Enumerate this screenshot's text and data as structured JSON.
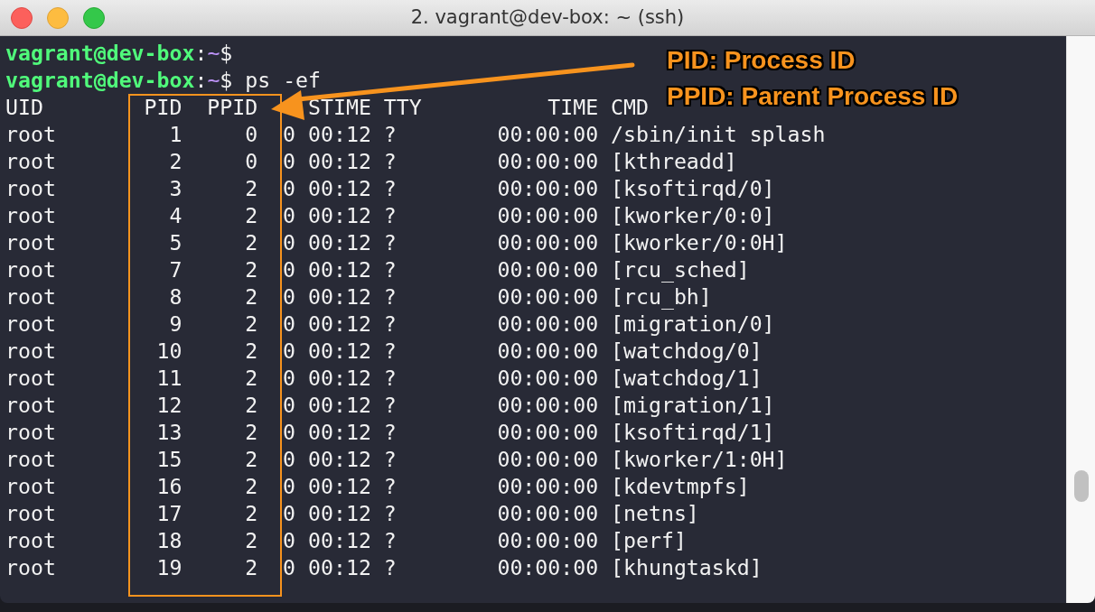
{
  "window": {
    "title": "2. vagrant@dev-box: ~ (ssh)"
  },
  "terminal": {
    "lines": [
      {
        "kind": "prompt",
        "user_host": "vagrant@dev-box",
        "separator": ":",
        "path": "~",
        "symbol": "$"
      },
      {
        "kind": "prompt",
        "user_host": "vagrant@dev-box",
        "separator": ":",
        "path": "~",
        "symbol": "$",
        "command": " ps -ef"
      },
      {
        "kind": "output",
        "text": "UID        PID  PPID    STIME TTY          TIME CMD"
      },
      {
        "kind": "output",
        "text": "root         1     0  0 00:12 ?        00:00:00 /sbin/init splash"
      },
      {
        "kind": "output",
        "text": "root         2     0  0 00:12 ?        00:00:00 [kthreadd]"
      },
      {
        "kind": "output",
        "text": "root         3     2  0 00:12 ?        00:00:00 [ksoftirqd/0]"
      },
      {
        "kind": "output",
        "text": "root         4     2  0 00:12 ?        00:00:00 [kworker/0:0]"
      },
      {
        "kind": "output",
        "text": "root         5     2  0 00:12 ?        00:00:00 [kworker/0:0H]"
      },
      {
        "kind": "output",
        "text": "root         7     2  0 00:12 ?        00:00:00 [rcu_sched]"
      },
      {
        "kind": "output",
        "text": "root         8     2  0 00:12 ?        00:00:00 [rcu_bh]"
      },
      {
        "kind": "output",
        "text": "root         9     2  0 00:12 ?        00:00:00 [migration/0]"
      },
      {
        "kind": "output",
        "text": "root        10     2  0 00:12 ?        00:00:00 [watchdog/0]"
      },
      {
        "kind": "output",
        "text": "root        11     2  0 00:12 ?        00:00:00 [watchdog/1]"
      },
      {
        "kind": "output",
        "text": "root        12     2  0 00:12 ?        00:00:00 [migration/1]"
      },
      {
        "kind": "output",
        "text": "root        13     2  0 00:12 ?        00:00:00 [ksoftirqd/1]"
      },
      {
        "kind": "output",
        "text": "root        15     2  0 00:12 ?        00:00:00 [kworker/1:0H]"
      },
      {
        "kind": "output",
        "text": "root        16     2  0 00:12 ?        00:00:00 [kdevtmpfs]"
      },
      {
        "kind": "output",
        "text": "root        17     2  0 00:12 ?        00:00:00 [netns]"
      },
      {
        "kind": "output",
        "text": "root        18     2  0 00:12 ?        00:00:00 [perf]"
      },
      {
        "kind": "output",
        "text": "root        19     2  0 00:12 ?        00:00:00 [khungtaskd]"
      }
    ]
  },
  "annotations": [
    "PID: Process ID",
    "PPID: Parent Process ID"
  ]
}
